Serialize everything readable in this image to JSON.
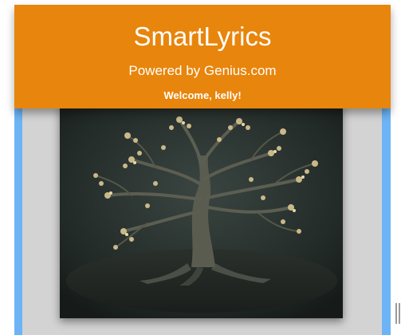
{
  "header": {
    "title": "SmartLyrics",
    "subtitle": "Powered by Genius.com",
    "welcome": "Welcome, kelly!"
  },
  "album_art": {
    "description_icon": "tree-album-art"
  },
  "colors": {
    "header_bg": "#e8850c",
    "header_text": "#ffffff",
    "rail": "#6cb4f5",
    "panel_bg": "#d3d3d3"
  }
}
